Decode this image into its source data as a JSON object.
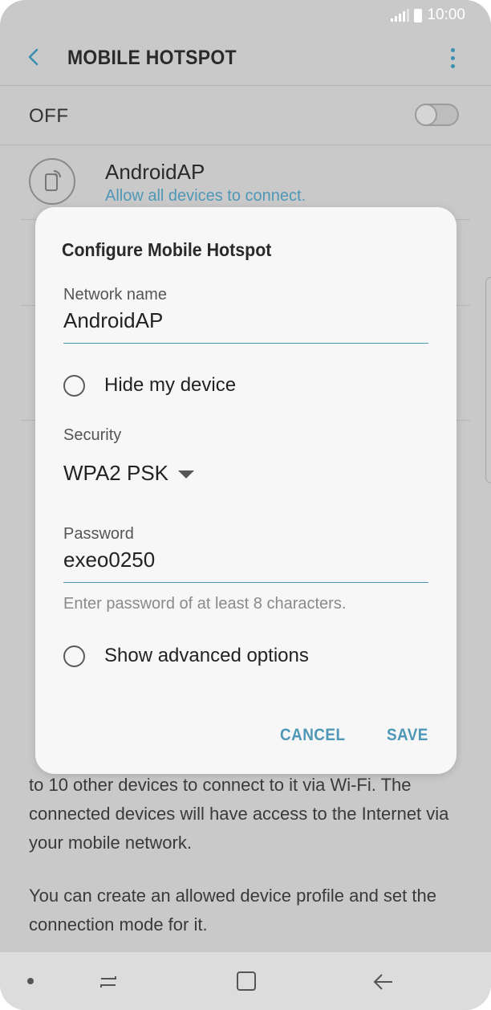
{
  "status_bar": {
    "time": "10:00"
  },
  "header": {
    "title": "MOBILE HOTSPOT"
  },
  "switch_row": {
    "label": "OFF"
  },
  "network": {
    "name": "AndroidAP",
    "subtitle": "Allow all devices to connect."
  },
  "description": [
    "to 10 other devices to connect to it via Wi-Fi. The connected devices will have access to the Internet via your mobile network.",
    "You can create an allowed device profile and set the connection mode for it."
  ],
  "dialog": {
    "title": "Configure Mobile Hotspot",
    "network_name_label": "Network name",
    "network_name_value": "AndroidAP",
    "hide_device_label": "Hide my device",
    "security_label": "Security",
    "security_value": "WPA2 PSK",
    "password_label": "Password",
    "password_value": "exeo0250",
    "password_hint": "Enter password of at least 8 characters.",
    "advanced_label": "Show advanced options",
    "cancel_label": "CANCEL",
    "save_label": "SAVE"
  },
  "colors": {
    "accent": "#4f97b6",
    "background": "#c9c9c9",
    "dialog": "#f7f7f7"
  }
}
